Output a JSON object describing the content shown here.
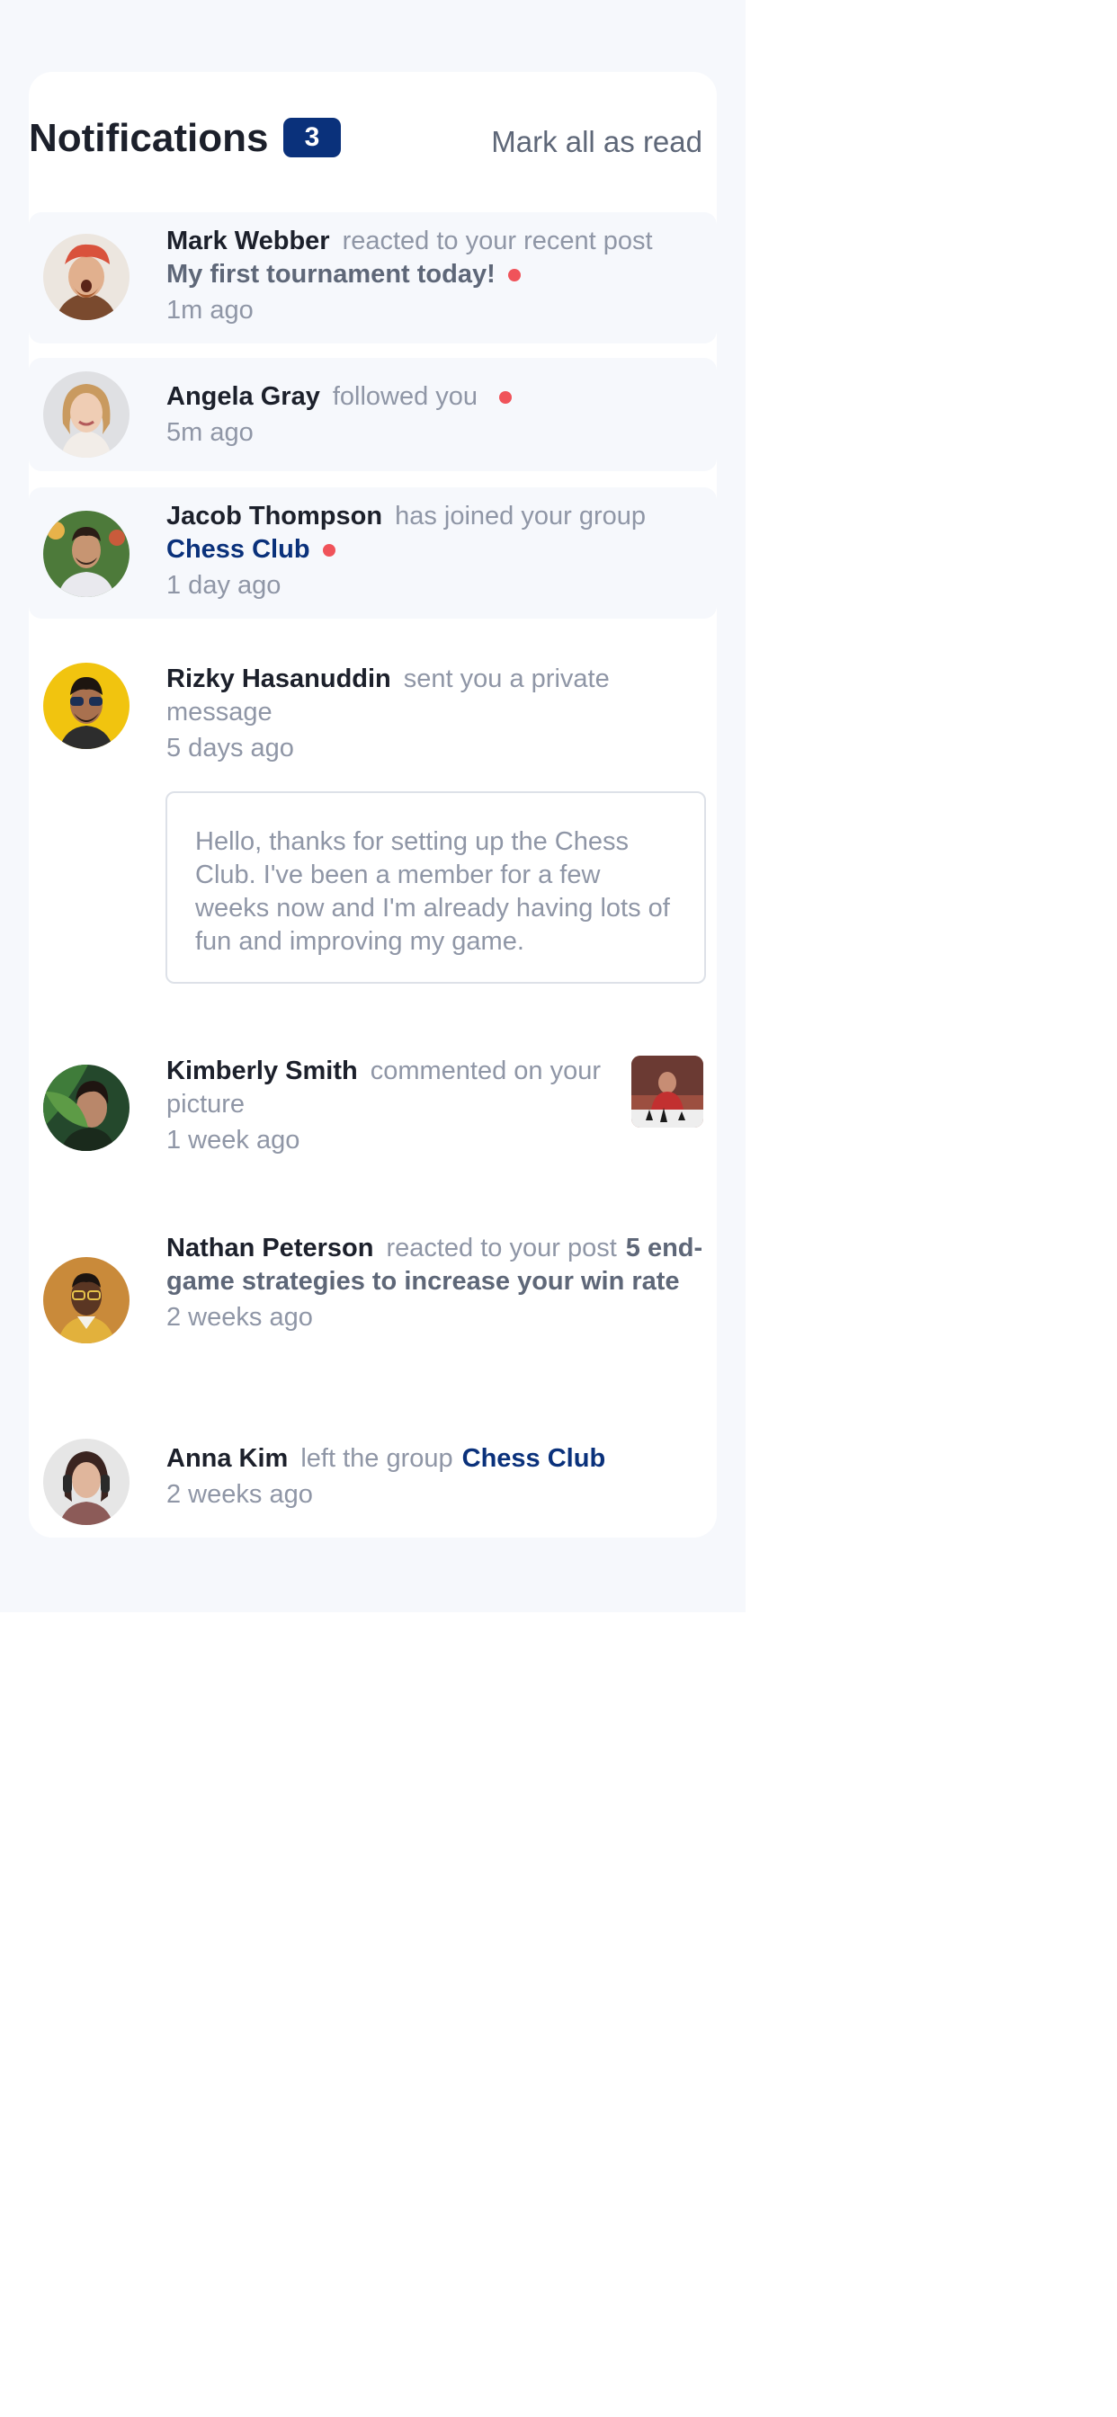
{
  "header": {
    "title": "Notifications",
    "unread_count": "3",
    "mark_all_label": "Mark all as read"
  },
  "colors": {
    "brand_navy": "#0a317b",
    "unread_dot": "#f0535a",
    "unread_bg": "#f6f8fc",
    "text_dark": "#1c202b",
    "text_muted": "#8f96a6"
  },
  "notifications": [
    {
      "name": "Mark Webber",
      "action": "reacted to your recent post",
      "post": "My first tournament today!",
      "time": "1m ago",
      "unread": true,
      "avatar": "avatar-mark-webber"
    },
    {
      "name": "Angela Gray",
      "action": "followed you",
      "time": "5m ago",
      "unread": true,
      "avatar": "avatar-angela-gray"
    },
    {
      "name": "Jacob Thompson",
      "action": "has joined your group",
      "group": "Chess Club",
      "time": "1 day ago",
      "unread": true,
      "avatar": "avatar-jacob-thompson"
    },
    {
      "name": "Rizky Hasanuddin",
      "action": "sent you a private message",
      "time": "5 days ago",
      "message": "Hello, thanks for setting up the Chess Club. I've been a member for a few weeks now and I'm already having lots of fun and improving my game.",
      "unread": false,
      "avatar": "avatar-rizky-hasanuddin"
    },
    {
      "name": "Kimberly Smith",
      "action": "commented on your picture",
      "time": "1 week ago",
      "unread": false,
      "avatar": "avatar-kimberly-smith",
      "picture": "chess-picture-thumbnail"
    },
    {
      "name": "Nathan Peterson",
      "action": "reacted to your post",
      "post": "5 end-game strategies to increase your win rate",
      "time": "2 weeks ago",
      "unread": false,
      "avatar": "avatar-nathan-peterson"
    },
    {
      "name": "Anna Kim",
      "action": "left the group",
      "group": "Chess Club",
      "time": "2 weeks ago",
      "unread": false,
      "avatar": "avatar-anna-kim"
    }
  ]
}
